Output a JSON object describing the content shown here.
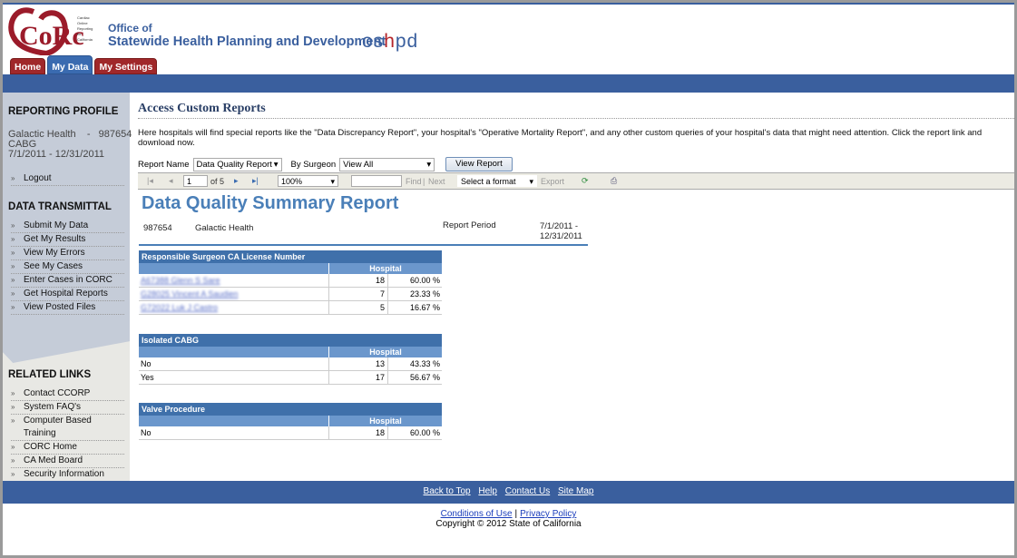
{
  "header": {
    "logo_text": "CORC",
    "logo_sub": "Cardiac Online Reporting for California",
    "office": "Office of",
    "agency": "Statewide Health Planning and Development",
    "brand": "oshpd"
  },
  "tabs": [
    {
      "label": "Home"
    },
    {
      "label": "My Data",
      "active": true
    },
    {
      "label": "My Settings"
    }
  ],
  "sidebar": {
    "profile_title": "REPORTING PROFILE",
    "hospital": "Galactic Health    -   987654",
    "program": "CABG",
    "period": "7/1/2011 - 12/31/2011",
    "logout": "Logout",
    "transmittal_title": "DATA TRANSMITTAL",
    "transmittal": [
      "Submit My Data",
      "Get My Results",
      "View My Errors",
      "See My Cases",
      "Enter Cases in CORC",
      "Get Hospital Reports",
      "View Posted Files"
    ],
    "related_title": "RELATED LINKS",
    "related": [
      "Contact CCORP",
      "System FAQ's",
      "Computer Based Training",
      "CORC Home",
      "CA Med Board",
      "Security Information"
    ]
  },
  "main": {
    "title": "Access Custom Reports",
    "intro": "Here hospitals will find special reports like the \"Data Discrepancy Report\", your hospital's \"Operative Mortality Report\", and any other custom queries of your hospital's data that might need attention. Click the report link and download now.",
    "report_name_label": "Report Name",
    "report_name_value": "Data Quality Report",
    "surgeon_label": "By Surgeon",
    "surgeon_value": "View All",
    "view_button": "View Report"
  },
  "toolbar": {
    "page": "1",
    "of": "of 5",
    "zoom": "100%",
    "find_value": "",
    "find": "Find",
    "sep": "|",
    "next": "Next",
    "format": "Select a format",
    "export": "Export"
  },
  "report": {
    "title": "Data Quality Summary Report",
    "id": "987654",
    "hospital": "Galactic Health",
    "period_label": "Report Period",
    "period_start": "7/1/2011 -",
    "period_end": "12/31/2011",
    "sections": [
      {
        "title": "Responsible Surgeon CA License Number",
        "col": "Hospital",
        "rows": [
          {
            "label": "A67388 Glenn S Sare",
            "n": "18",
            "p": "60.00 %",
            "blurred": true
          },
          {
            "label": "G28025 Vincent A Saudien",
            "n": "7",
            "p": "23.33 %",
            "blurred": true
          },
          {
            "label": "G72022 Luk J Castro",
            "n": "5",
            "p": "16.67 %",
            "blurred": true
          }
        ]
      },
      {
        "title": "Isolated CABG",
        "col": "Hospital",
        "rows": [
          {
            "label": "No",
            "n": "13",
            "p": "43.33 %"
          },
          {
            "label": "Yes",
            "n": "17",
            "p": "56.67 %"
          }
        ]
      },
      {
        "title": "Valve Procedure",
        "col": "Hospital",
        "rows": [
          {
            "label": "No",
            "n": "18",
            "p": "60.00 %"
          }
        ]
      }
    ]
  },
  "footer": {
    "links": [
      "Back to Top",
      "Help",
      "Contact Us",
      "Site Map"
    ],
    "conditions": "Conditions of Use",
    "privacy": "Privacy Policy",
    "copyright": "Copyright © 2012 State of California"
  },
  "colors": {
    "brand_blue": "#3a5f9e",
    "tab_red": "#a0282a",
    "report_blue": "#4a7fb8"
  }
}
